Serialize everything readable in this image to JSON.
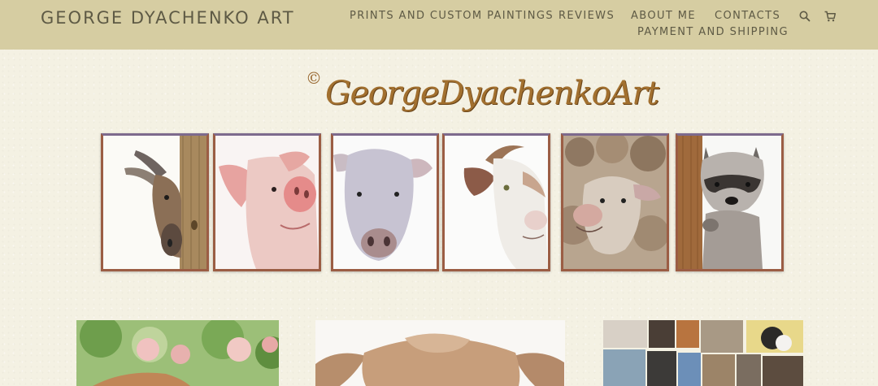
{
  "header": {
    "brand": "GEORGE DYACHENKO ART",
    "nav": {
      "prints": "PRINTS AND CUSTOM PAINTINGS",
      "reviews": "REVIEWS",
      "about": "ABOUT ME",
      "contacts": "CONTACTS",
      "payment": "PAYMENT AND SHIPPING"
    },
    "icons": {
      "search": "search-icon",
      "cart": "cart-icon"
    }
  },
  "hero": {
    "copyright": "©",
    "signature": "GeorgeDyachenkoArt",
    "paintings": [
      "donkey",
      "pig",
      "cow",
      "goat",
      "sheep",
      "raccoon"
    ]
  },
  "gallery": {
    "tiles": [
      "floral-fox-painting",
      "calf-painting",
      "animal-collage"
    ]
  },
  "colors": {
    "header_bg": "#d6cda2",
    "nav_text": "#5e5a45",
    "page_bg": "#f4f1e3",
    "signature": "#a2702f",
    "frame": "#9b5d44"
  }
}
